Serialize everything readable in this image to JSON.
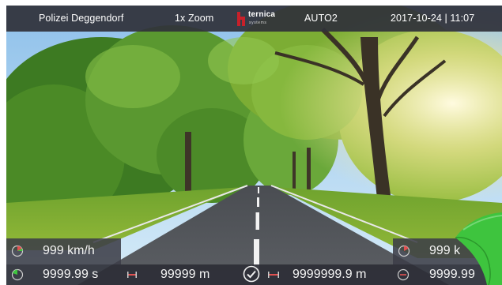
{
  "header": {
    "location": "Polizei Deggendorf",
    "zoom": "1x Zoom",
    "logo_name": "ternica",
    "logo_sub": "systems",
    "mode": "AUTO2",
    "datetime": "2017-10-24 | 11:07"
  },
  "speed_left": {
    "value": "999 km/h",
    "icon": "speed-gauge-icon"
  },
  "speed_right": {
    "value": "999 k",
    "icon": "speed-gauge-icon"
  },
  "bottom": {
    "time_value": "9999.99 s",
    "distance_value": "99999 m",
    "total_distance_value": "9999999.9 m",
    "right_value": "9999.99",
    "time_icon": "timer-icon",
    "distance_icon": "ruler-icon",
    "check_icon": "check-circle-icon",
    "total_distance_icon": "ruler-icon",
    "right_icon": "gauge-icon"
  },
  "colors": {
    "bar_bg": "#30323a",
    "accent_green": "#3ec43e",
    "gauge_red": "#e05050",
    "logo_red": "#c8202a"
  }
}
